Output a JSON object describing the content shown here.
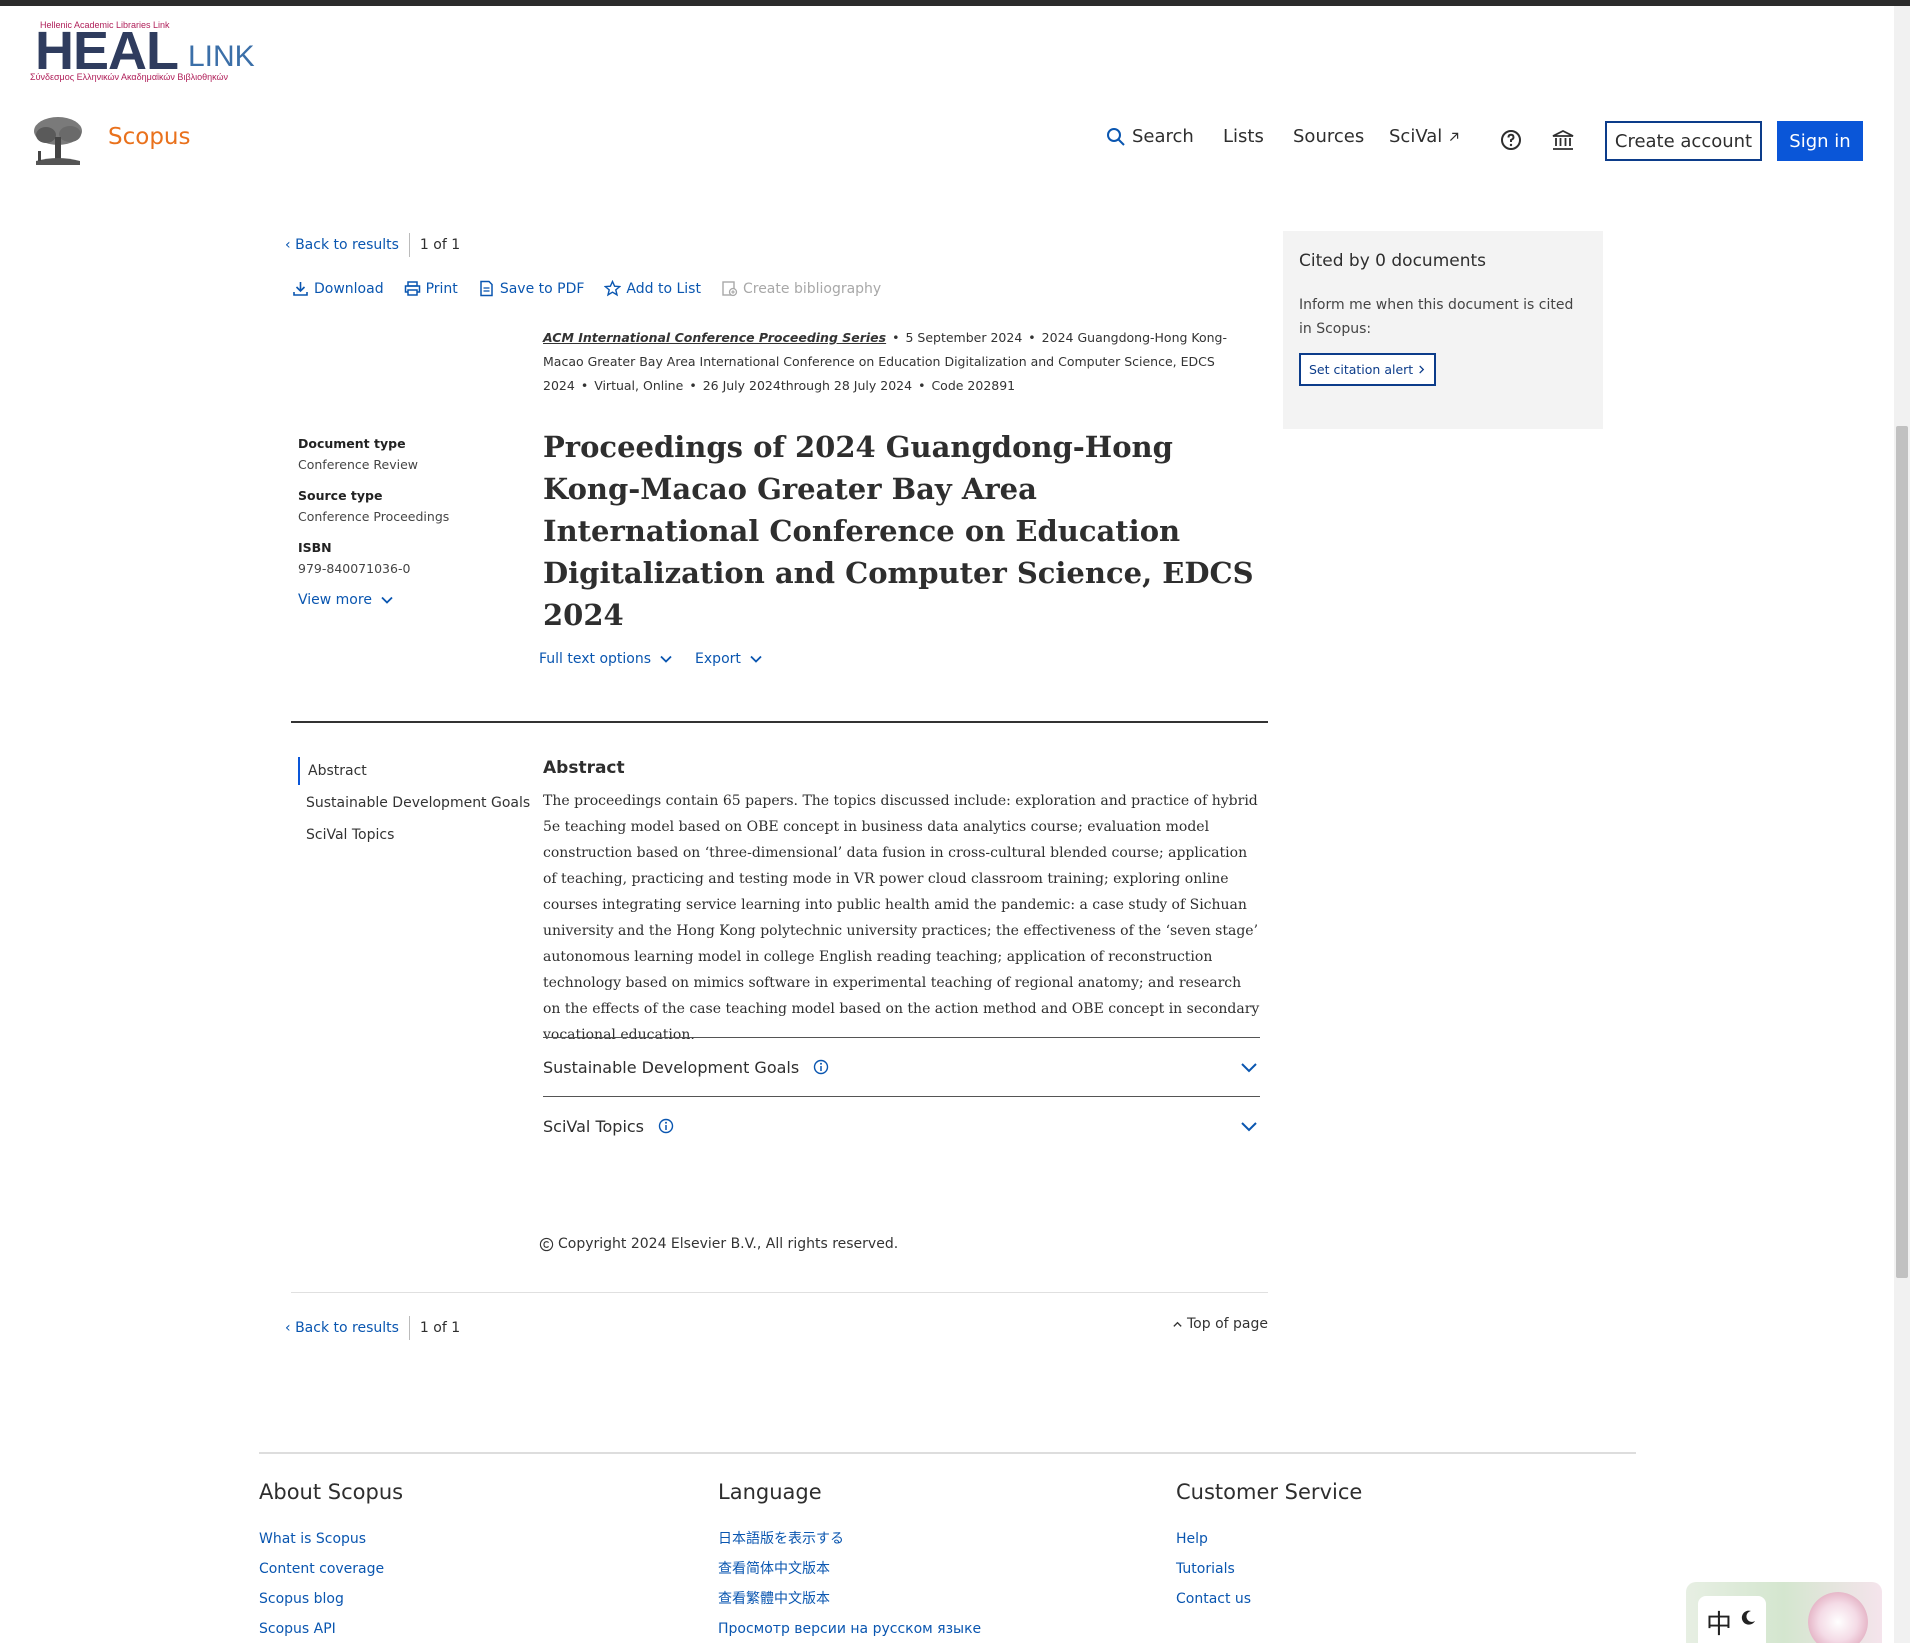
{
  "heal_logo": {
    "top_text": "Hellenic Academic Libraries Link",
    "main": "HEAL",
    "suffix": "LINK",
    "subtitle": "Σύνδεσμος Ελληνικών Ακαδημαϊκών Βιβλιοθηκών"
  },
  "header": {
    "brand": "Scopus",
    "nav": {
      "search": "Search",
      "lists": "Lists",
      "sources": "Sources",
      "scival": "SciVal"
    },
    "create_account": "Create account",
    "sign_in": "Sign in"
  },
  "pager": {
    "back": "Back to results",
    "current": "1",
    "of": "of",
    "total": "1"
  },
  "toolbar": {
    "download": "Download",
    "print": "Print",
    "save_pdf": "Save to PDF",
    "add_list": "Add to List",
    "bibliography": "Create bibliography"
  },
  "source": {
    "series": "ACM International Conference Proceeding Series",
    "date": "5 September 2024",
    "conference": "2024 Guangdong-Hong Kong-Macao Greater Bay Area International Conference on Education Digitalization and Computer Science, EDCS 2024",
    "location": "Virtual, Online",
    "dates": "26 July 2024through 28 July 2024",
    "code": "Code 202891"
  },
  "doc_meta": {
    "doc_type_label": "Document type",
    "doc_type": "Conference Review",
    "source_type_label": "Source type",
    "source_type": "Conference Proceedings",
    "isbn_label": "ISBN",
    "isbn": "979-840071036-0",
    "view_more": "View more"
  },
  "title": "Proceedings of 2024 Guangdong-Hong Kong-Macao Greater Bay Area International Conference on Education Digitalization and Computer Science, EDCS 2024",
  "options": {
    "full_text": "Full text options",
    "export": "Export"
  },
  "toc": [
    "Abstract",
    "Sustainable Development Goals",
    "SciVal Topics"
  ],
  "abstract": {
    "heading": "Abstract",
    "text": "The proceedings contain 65 papers. The topics discussed include: exploration and practice of hybrid 5e teaching model based on OBE concept in business data analytics course; evaluation model construction based on ‘three-dimensional’ data fusion in cross-cultural blended course; application of teaching, practicing and testing mode in VR power cloud classroom training; exploring online courses integrating service learning into public health amid the pandemic: a case study of Sichuan university and the Hong Kong polytechnic university practices; the effectiveness of the ‘seven stage’ autonomous learning model in college English reading teaching; application of reconstruction technology based on mimics software in experimental teaching of regional anatomy; and research on the effects of the case teaching model based on the action method and OBE concept in secondary vocational education."
  },
  "accordions": {
    "sdg": "Sustainable Development Goals",
    "scival": "SciVal Topics"
  },
  "copyright": "Copyright 2024 Elsevier B.V., All rights reserved.",
  "top_of_page": "Top of page",
  "citations": {
    "title": "Cited by 0 documents",
    "inform": "Inform me when this document is cited in Scopus:",
    "button": "Set citation alert"
  },
  "footer": {
    "about": {
      "title": "About Scopus",
      "links": [
        "What is Scopus",
        "Content coverage",
        "Scopus blog",
        "Scopus API"
      ]
    },
    "language": {
      "title": "Language",
      "links": [
        "日本語版を表示する",
        "查看简体中文版本",
        "查看繁體中文版本",
        "Просмотр версии на русском языке"
      ]
    },
    "service": {
      "title": "Customer Service",
      "links": [
        "Help",
        "Tutorials",
        "Contact us"
      ]
    }
  },
  "ime": {
    "label": "中"
  },
  "colors": {
    "accent": "#0a56d8",
    "brand": "#e9711c",
    "link": "#0a56b0"
  }
}
